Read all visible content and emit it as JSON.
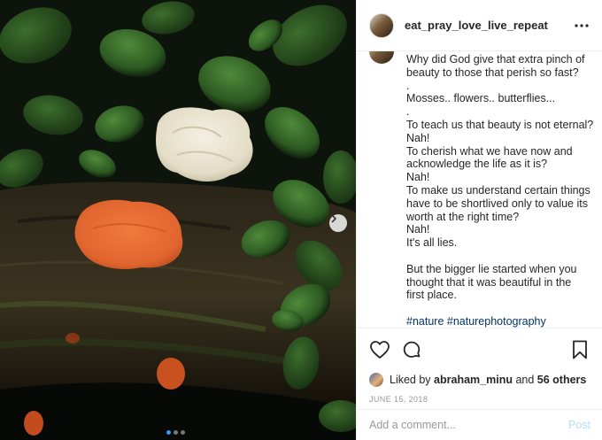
{
  "post": {
    "username": "eat_pray_love_live_repeat",
    "caption_lines": [
      "Why did God give that extra pinch of",
      "beauty to those that perish so fast?",
      ".",
      "Mosses.. flowers.. butterflies...",
      ".",
      "To teach us that beauty is not eternal?",
      "Nah!",
      "To cherish what we have now and",
      "acknowledge the life as it is?",
      "Nah!",
      "To make us understand certain things",
      "have to be shortlived only to value its",
      "worth at the right time?",
      "Nah!",
      "It's all lies.",
      "",
      "But the bigger lie started when you",
      "thought that it was beautiful in the",
      "first place.",
      ""
    ],
    "hashtags": "#nature #naturephotography",
    "likes": {
      "prefix": "Liked by",
      "user": "abraham_minu",
      "connector": "and",
      "others": "56 others"
    },
    "date": "JUNE 15, 2018"
  },
  "comment": {
    "placeholder": "Add a comment...",
    "post_label": "Post"
  },
  "carousel": {
    "count": 3,
    "active": 0
  },
  "icons": {
    "more": "more-horizontal-icon",
    "like": "heart-icon",
    "comment": "comment-bubble-icon",
    "save": "bookmark-icon",
    "next": "chevron-right-icon"
  },
  "colors": {
    "hashtag": "#003569",
    "post_disabled": "#b2dffc",
    "dot_active": "#3897f0",
    "fungus_orange": "#e0642e"
  }
}
